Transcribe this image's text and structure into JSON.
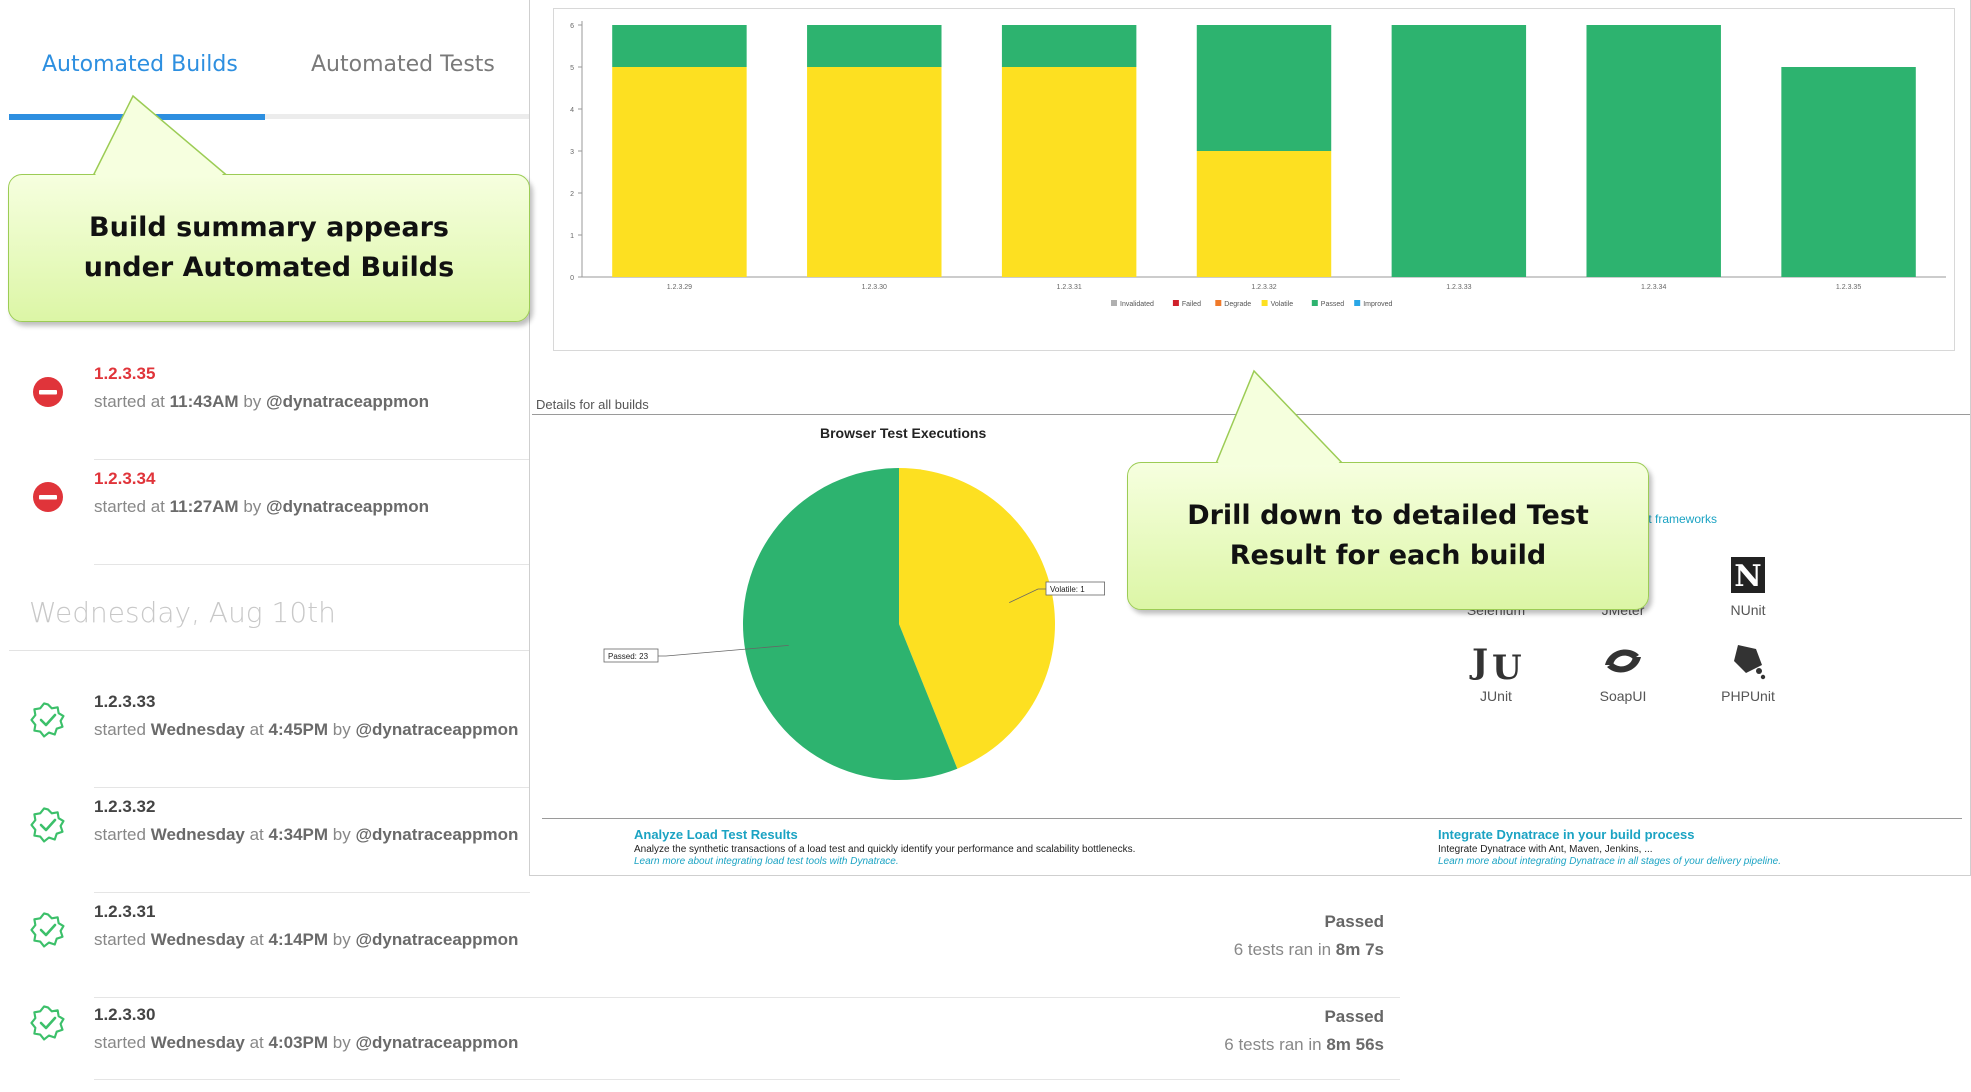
{
  "tabs": {
    "automated_builds": "Automated Builds",
    "automated_tests": "Automated Tests"
  },
  "builds_today": [
    {
      "number": "1.2.3.35",
      "status": "failed",
      "started_prefix": "started at ",
      "started_time": "11:43AM",
      "by": " by ",
      "user": "@dynatraceappmon"
    },
    {
      "number": "1.2.3.34",
      "status": "failed",
      "started_prefix": "started at ",
      "started_time": "11:27AM",
      "by": " by ",
      "user": "@dynatraceappmon"
    }
  ],
  "day_header": "Wednesday, Aug 10th",
  "builds_earlier": [
    {
      "number": "1.2.3.33",
      "status": "passed",
      "started_prefix": "started ",
      "started_day": "Wednesday",
      "at": " at ",
      "started_time": "4:45PM",
      "by": " by ",
      "user": "@dynatraceappmon"
    },
    {
      "number": "1.2.3.32",
      "status": "passed",
      "started_prefix": "started ",
      "started_day": "Wednesday",
      "at": " at ",
      "started_time": "4:34PM",
      "by": " by ",
      "user": "@dynatraceappmon"
    },
    {
      "number": "1.2.3.31",
      "status": "passed",
      "started_prefix": "started ",
      "started_day": "Wednesday",
      "at": " at ",
      "started_time": "4:14PM",
      "by": " by ",
      "user": "@dynatraceappmon",
      "result_label": "Passed",
      "result_prefix": "6 tests ran in ",
      "result_duration": "8m 7s"
    },
    {
      "number": "1.2.3.30",
      "status": "passed",
      "started_prefix": "started ",
      "started_day": "Wednesday",
      "at": " at ",
      "started_time": "4:03PM",
      "by": " by ",
      "user": "@dynatraceappmon",
      "result_label": "Passed",
      "result_prefix": "6 tests ran in ",
      "result_duration": "8m 56s"
    }
  ],
  "report": {
    "details_label": "Details for all builds",
    "pie_title": "Browser Test Executions",
    "frameworks_link": "r test frameworks",
    "frameworks": [
      {
        "name": "Selenium",
        "icon": "selenium-icon"
      },
      {
        "name": "JMeter",
        "icon": "jmeter-icon"
      },
      {
        "name": "NUnit",
        "icon": "nunit-icon"
      },
      {
        "name": "JUnit",
        "icon": "junit-icon"
      },
      {
        "name": "SoapUI",
        "icon": "soapui-icon"
      },
      {
        "name": "PHPUnit",
        "icon": "phpunit-icon"
      }
    ],
    "promo_left": {
      "title": "Analyze Load Test Results",
      "text": "Analyze the synthetic transactions of a load test and quickly identify your performance and scalability bottlenecks.",
      "more": "Learn more about integrating load test tools with Dynatrace."
    },
    "promo_right": {
      "title": "Integrate Dynatrace in your build process",
      "text": "Integrate Dynatrace with Ant, Maven, Jenkins, ...",
      "more": "Learn more about integrating Dynatrace in all stages of your delivery pipeline."
    }
  },
  "callouts": {
    "builds": "Build summary appears under Automated Builds",
    "drill": "Drill down to detailed Test Result for each build"
  },
  "colors": {
    "accent": "#2d8fe0",
    "failed": "#e0343a",
    "passed_icon": "#3cc06a",
    "chart_passed": "#2db36f",
    "chart_volatile": "#fde021",
    "chart_invalidated": "#b0b0b0",
    "chart_failed": "#d0202a",
    "chart_degraded": "#f07a2a",
    "chart_improved": "#2aa6e6",
    "link": "#1ba3c3"
  },
  "chart_data": [
    {
      "type": "bar",
      "stacked": true,
      "categories": [
        "1.2.3.29",
        "1.2.3.30",
        "1.2.3.31",
        "1.2.3.32",
        "1.2.3.33",
        "1.2.3.34",
        "1.2.3.35"
      ],
      "ylim": [
        0,
        6
      ],
      "yticks": [
        "0",
        "1",
        "2",
        "3",
        "4",
        "5",
        "6"
      ],
      "series": [
        {
          "name": "Invalidated",
          "color": "#b0b0b0",
          "values": [
            0,
            0,
            0,
            0,
            0,
            0,
            0
          ]
        },
        {
          "name": "Failed",
          "color": "#d0202a",
          "values": [
            0,
            0,
            0,
            0,
            0,
            0,
            0
          ]
        },
        {
          "name": "Degraded",
          "color": "#f07a2a",
          "values": [
            0,
            0,
            0,
            0,
            0,
            0,
            0
          ]
        },
        {
          "name": "Volatile",
          "color": "#fde021",
          "values": [
            5,
            5,
            5,
            3,
            0,
            0,
            0
          ]
        },
        {
          "name": "Passed",
          "color": "#2db36f",
          "values": [
            1,
            1,
            1,
            3,
            6,
            6,
            5
          ]
        },
        {
          "name": "Improved",
          "color": "#2aa6e6",
          "values": [
            0,
            0,
            0,
            0,
            0,
            0,
            0
          ]
        }
      ],
      "legend": "bottom",
      "legend_labels": [
        "Invalidated",
        "Failed",
        "Degrade",
        "Volatile",
        "Passed",
        "Improved"
      ],
      "grid": false
    },
    {
      "type": "pie",
      "title": "Browser Test Executions",
      "slices": [
        {
          "label": "Volatile",
          "display": "Volatile: 1",
          "value": 18,
          "color": "#fde021"
        },
        {
          "label": "Passed",
          "display": "Passed: 23",
          "value": 23,
          "color": "#2db36f"
        }
      ]
    }
  ]
}
